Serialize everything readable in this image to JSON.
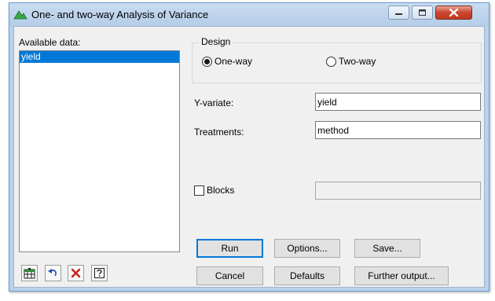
{
  "window": {
    "title": "One- and two-way Analysis of Variance"
  },
  "available_data": {
    "label": "Available data:",
    "items": [
      {
        "label": "yield",
        "selected": true
      }
    ]
  },
  "design": {
    "legend": "Design",
    "options": [
      {
        "label": "One-way",
        "checked": true
      },
      {
        "label": "Two-way",
        "checked": false
      }
    ]
  },
  "fields": {
    "y_variate": {
      "label": "Y-variate:",
      "value": "yield"
    },
    "treatments": {
      "label": "Treatments:",
      "value": "method"
    },
    "blocks": {
      "label": "Blocks",
      "checked": false,
      "value": ""
    }
  },
  "buttons": {
    "run": "Run",
    "options": "Options...",
    "save": "Save...",
    "cancel": "Cancel",
    "defaults": "Defaults",
    "further_output": "Further output..."
  },
  "toolbar": {
    "icons": [
      "spreadsheet-icon",
      "undo-icon",
      "clear-icon",
      "help-icon"
    ]
  },
  "colors": {
    "selection": "#0078d7",
    "title_bar": "#b9d1ea",
    "close_button": "#c9452e"
  }
}
